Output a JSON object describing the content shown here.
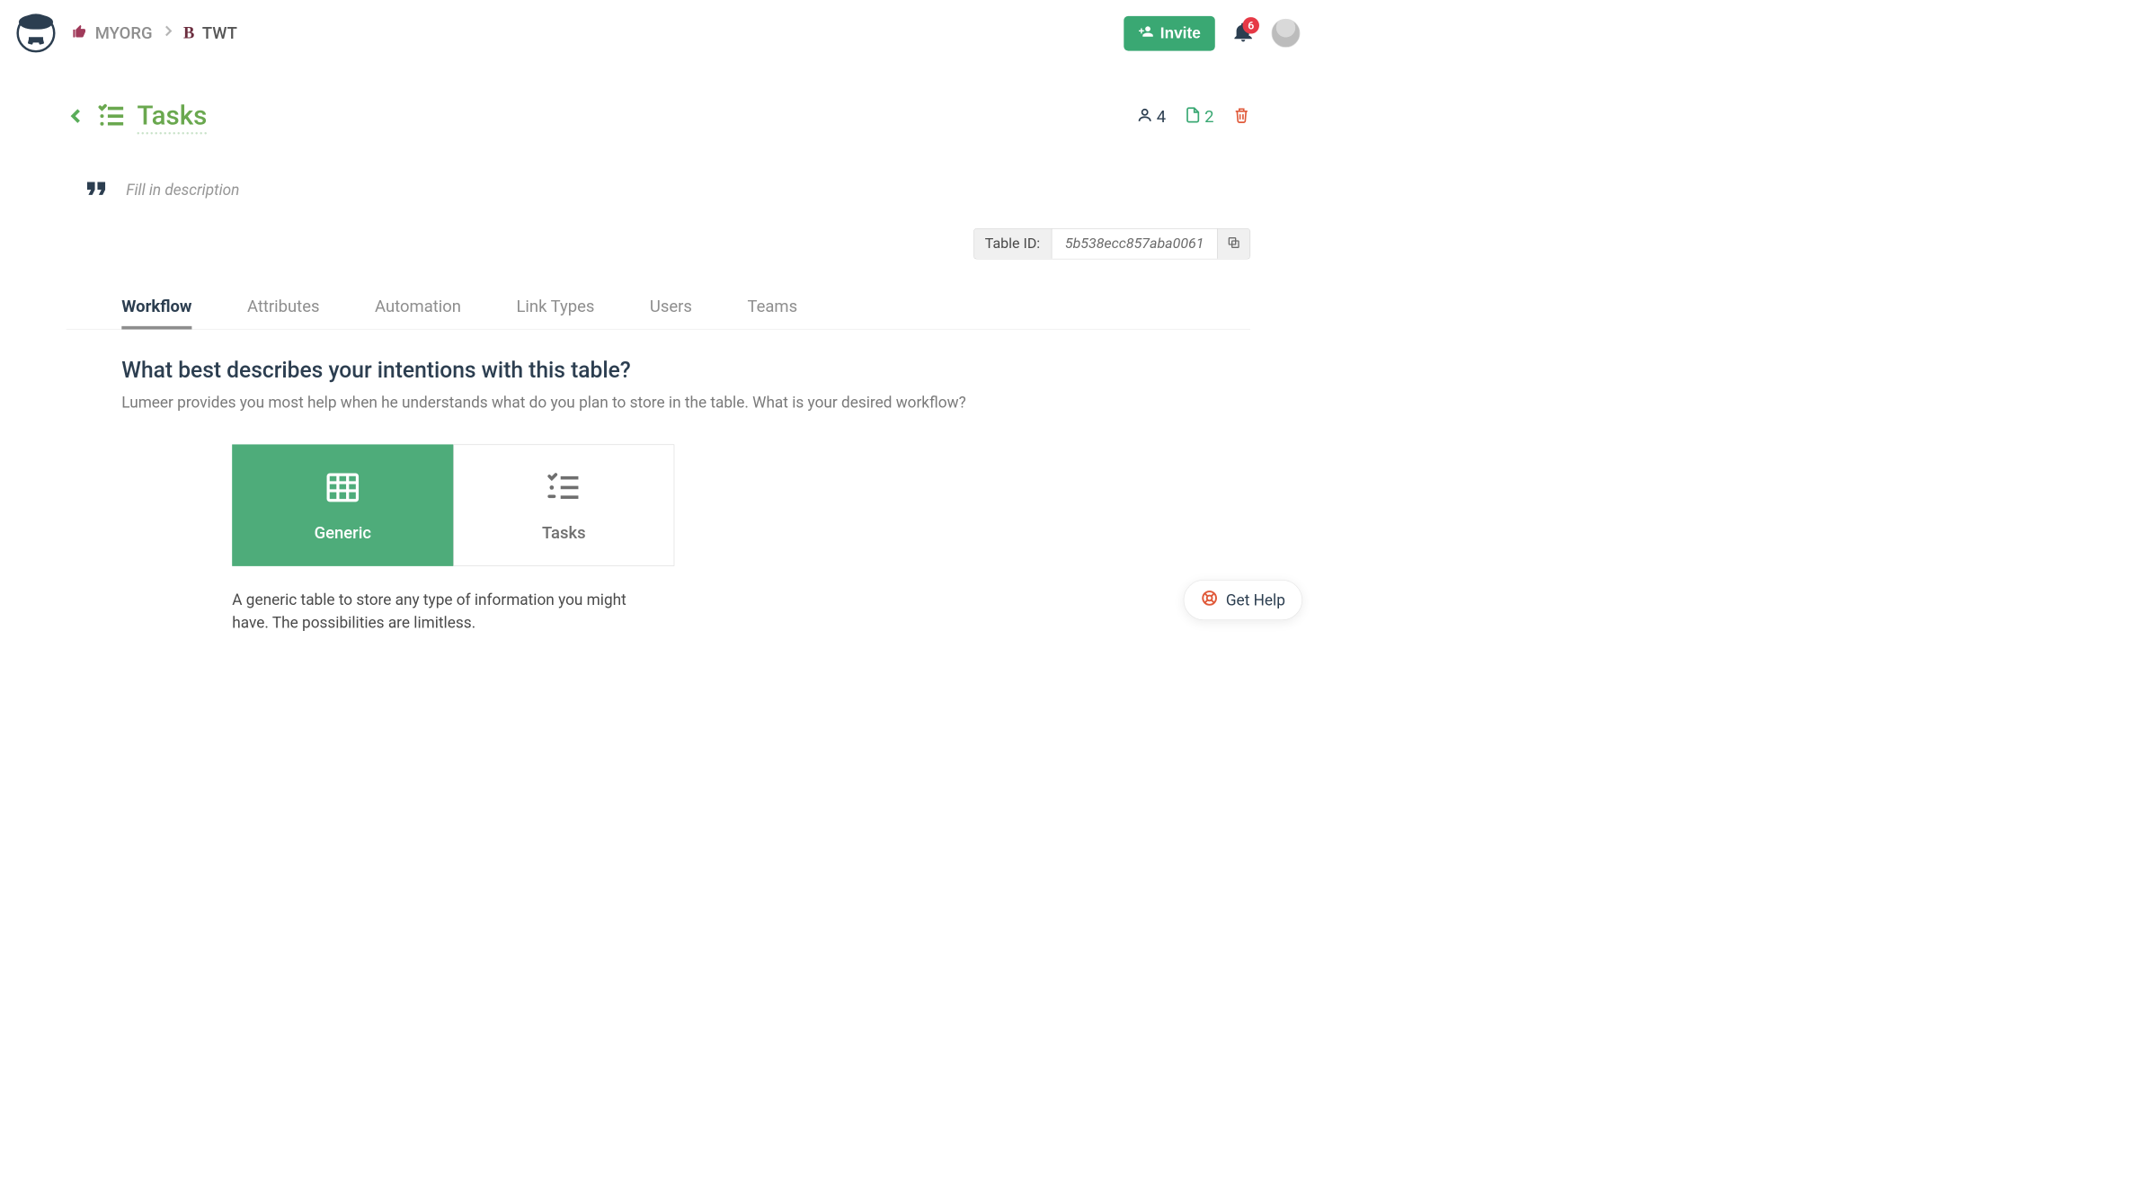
{
  "breadcrumb": {
    "org": "MYORG",
    "project": "TWT"
  },
  "header": {
    "invite_label": "Invite",
    "notification_count": "6"
  },
  "page": {
    "title": "Tasks",
    "description_placeholder": "Fill in description",
    "user_count": "4",
    "file_count": "2",
    "table_id_label": "Table ID:",
    "table_id_value": "5b538ecc857aba0061"
  },
  "tabs": [
    {
      "label": "Workflow"
    },
    {
      "label": "Attributes"
    },
    {
      "label": "Automation"
    },
    {
      "label": "Link Types"
    },
    {
      "label": "Users"
    },
    {
      "label": "Teams"
    }
  ],
  "workflow": {
    "heading": "What best describes your intentions with this table?",
    "subheading": "Lumeer provides you most help when he understands what do you plan to store in the table. What is your desired workflow?",
    "cards": [
      {
        "label": "Generic"
      },
      {
        "label": "Tasks"
      }
    ],
    "selected_desc": "A generic table to store any type of information you might have. The possibilities are limitless."
  },
  "help": {
    "label": "Get Help"
  }
}
